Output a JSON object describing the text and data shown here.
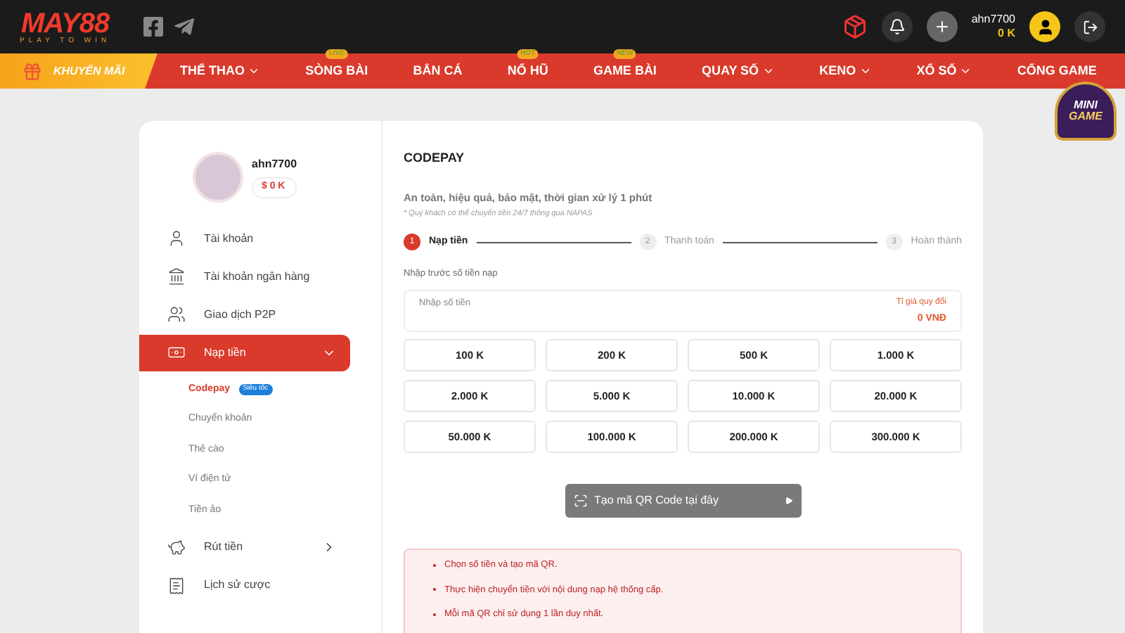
{
  "header": {
    "logo": {
      "brand": "MAY88",
      "tagline": "PLAY TO WIN"
    },
    "username": "ahn7700",
    "balance": "0 K"
  },
  "promo": {
    "label": "KHUYẾN MÃI"
  },
  "nav": [
    {
      "label": "THỂ THAO",
      "dropdown": true
    },
    {
      "label": "SÒNG BÀI",
      "badge": "LIVE"
    },
    {
      "label": "BẮN CÁ"
    },
    {
      "label": "NỔ HŨ",
      "badge": "HOT"
    },
    {
      "label": "GAME BÀI",
      "badge": "NEW"
    },
    {
      "label": "QUAY SỐ",
      "dropdown": true
    },
    {
      "label": "KENO",
      "dropdown": true
    },
    {
      "label": "XỔ SỐ",
      "dropdown": true
    },
    {
      "label": "CỔNG GAME"
    }
  ],
  "mini_game": {
    "line_1": "MINI",
    "line_2": "GAME"
  },
  "profile": {
    "name": "ahn7700",
    "balance": "$ 0 K"
  },
  "sidebar": [
    {
      "label": "Tài khoản",
      "selected": false
    },
    {
      "label": "Tài khoản ngân hàng",
      "selected": false
    },
    {
      "label": "Giao dịch P2P",
      "selected": false
    },
    {
      "label": "Nạp tiền",
      "selected": true,
      "expanded": true,
      "children": [
        {
          "label": "Codepay",
          "selected": true,
          "badge": "Siêu tốc"
        },
        {
          "label": "Chuyển khoản",
          "selected": false
        },
        {
          "label": "Thẻ cào",
          "selected": false
        },
        {
          "label": "Ví điện tử",
          "selected": false
        },
        {
          "label": "Tiền ảo",
          "selected": false
        }
      ]
    },
    {
      "label": "Rút tiền",
      "selected": false,
      "expanded": false
    },
    {
      "label": "Lịch sử cược",
      "selected": false
    }
  ],
  "main": {
    "title": "CODEPAY",
    "subtitle": "An toàn, hiệu quả, bảo mật, thời gian xử lý 1 phút",
    "note": "* Quý khách có thể chuyển tiền 24/7 thông qua NAPAS",
    "steps": [
      {
        "number": "1",
        "label": "Nạp tiền",
        "selected": true
      },
      {
        "number": "2",
        "label": "Thanh toán",
        "selected": false
      },
      {
        "number": "3",
        "label": "Hoàn thành",
        "selected": false
      }
    ],
    "amount_label": "Nhập trước số tiền nạp",
    "amount_placeholder": "Nhập số tiền",
    "rate_label": "Tỉ giá quy đổi",
    "rate_value": "0 VNĐ",
    "amounts": [
      "100 K",
      "200 K",
      "500 K",
      "1.000 K",
      "2.000 K",
      "5.000 K",
      "10.000 K",
      "20.000 K",
      "50.000 K",
      "100.000 K",
      "200.000 K",
      "300.000 K"
    ],
    "qr_button": "Tạo mã QR Code tại đây",
    "instructions": [
      "Chọn số tiền và tạo mã QR.",
      "Thực hiện chuyển tiền với nội dung nạp hệ thống cấp.",
      "Mỗi mã QR chỉ sử dụng 1 lần duy nhất."
    ]
  }
}
